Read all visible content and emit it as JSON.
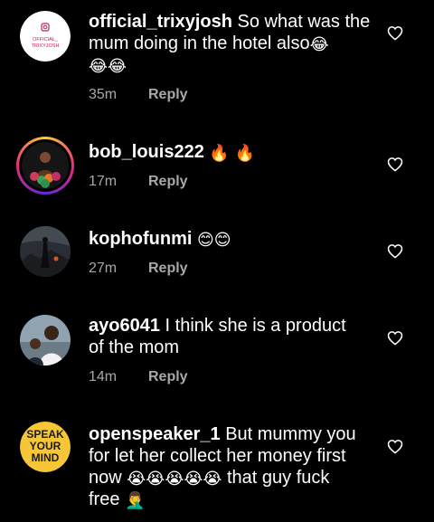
{
  "reply_label": "Reply",
  "comments": [
    {
      "username": "official_trixyjosh",
      "text": " So what was the mum doing in the hotel also",
      "emoji_inline": "😂",
      "emoji_line2": "😂😂",
      "time": "35m",
      "avatar_text_line1": "OFFICIAL_",
      "avatar_text_line2": "TRIXYJOSH"
    },
    {
      "username": "bob_louis222",
      "text": " ",
      "emoji_inline": "🔥 🔥",
      "time": "17m"
    },
    {
      "username": "kophofunmi",
      "text": " ",
      "emoji_inline": "😊😊",
      "time": "27m"
    },
    {
      "username": "ayo6041",
      "text": " I think she is a product",
      "line2": "of the mom",
      "time": "14m"
    },
    {
      "username": "openspeaker_1",
      "text": " But mummy you",
      "line2": "for let her collect her money first",
      "line3_a": "now ",
      "line3_emoji": "😭😭😭😭😭",
      "line3_b": " that guy fuck",
      "line4": "free ",
      "line4_emoji": "🤦‍♂️",
      "time": "",
      "avatar_text_line1": "SPEAK",
      "avatar_text_line2": "YOUR",
      "avatar_text_line3": "MIND"
    }
  ],
  "colors": {
    "background": "#000000",
    "text": "#ffffff",
    "meta": "#a8a8a8",
    "avatar_yellow": "#f6c637"
  },
  "icons": {
    "like": "heart-outline-icon"
  }
}
